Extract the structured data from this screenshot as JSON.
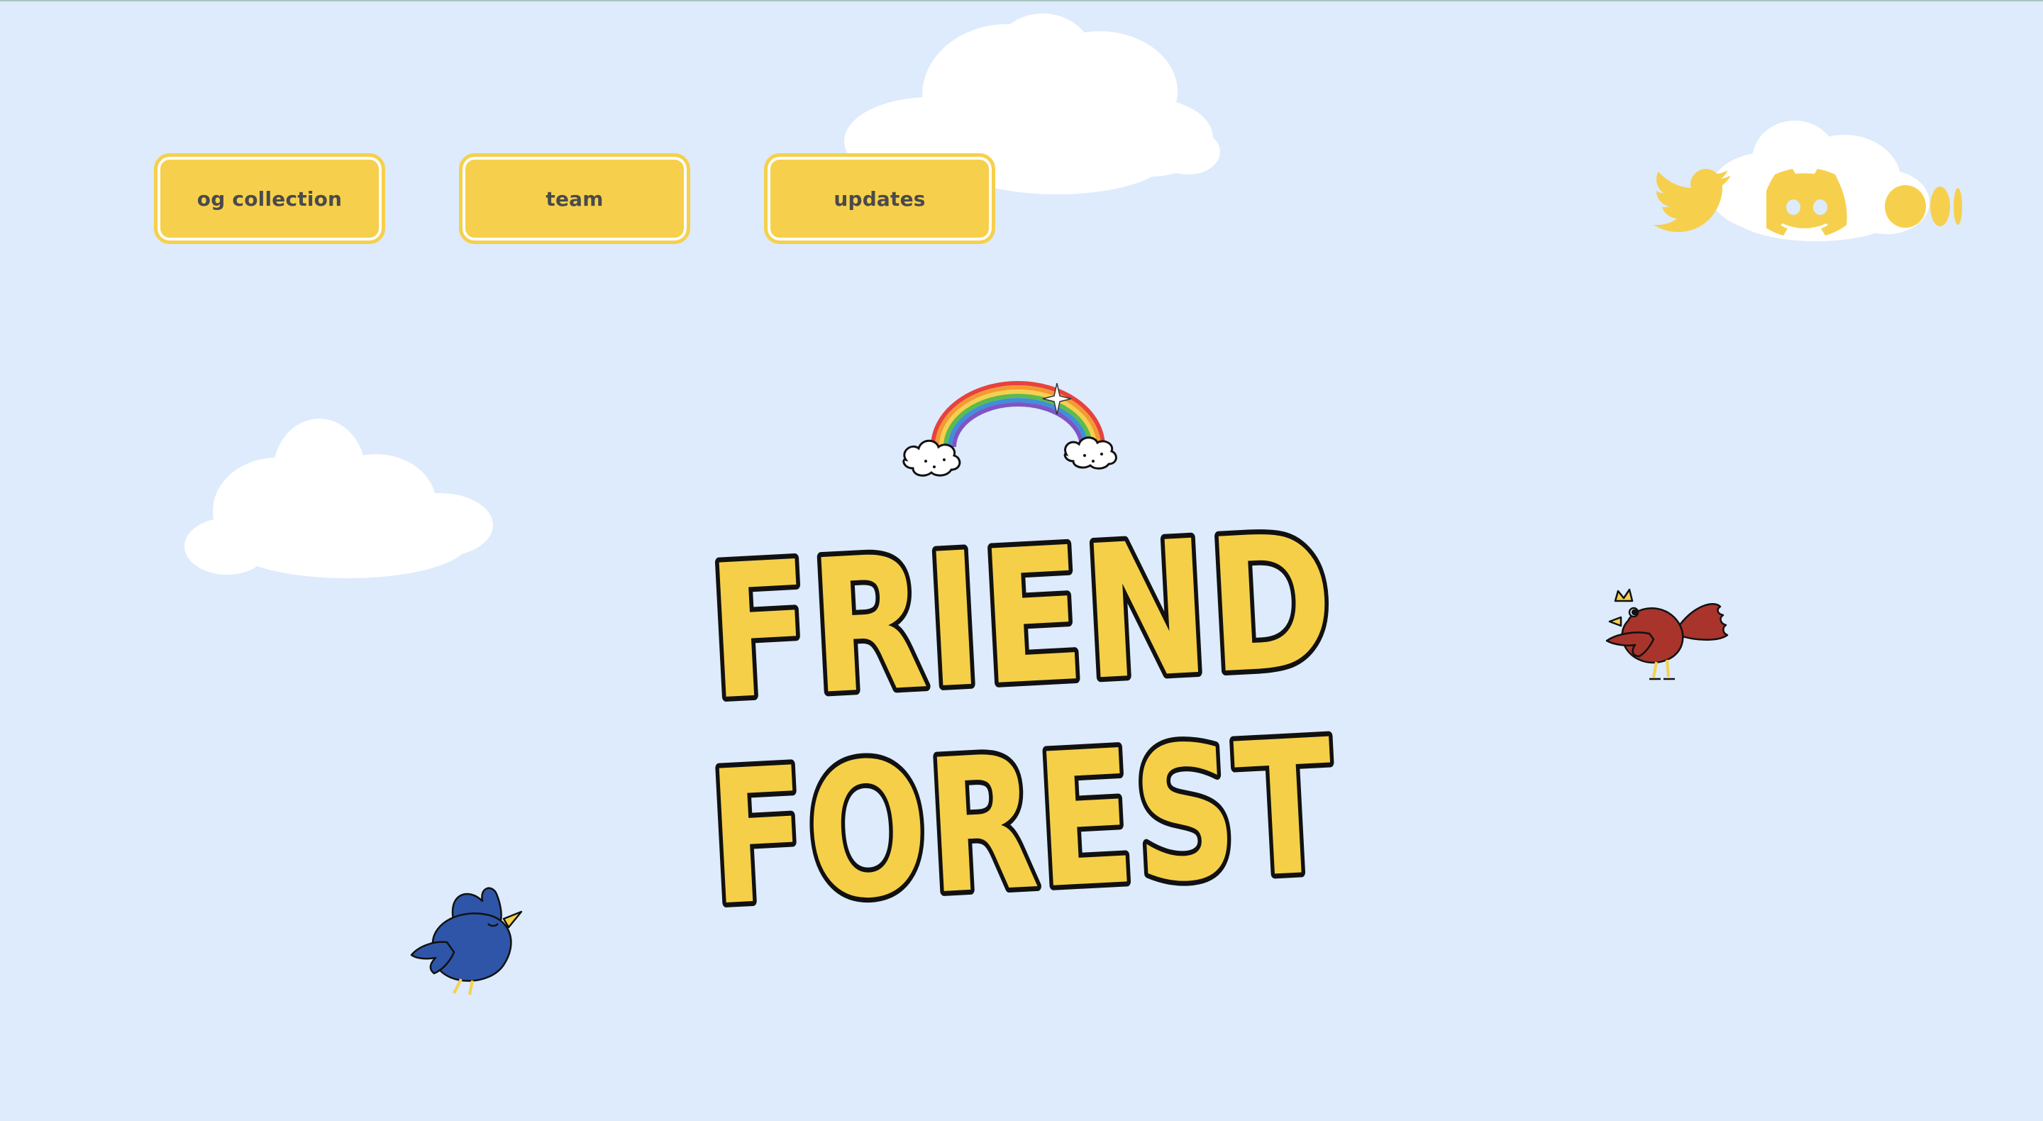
{
  "nav": {
    "items": [
      {
        "label": "og collection"
      },
      {
        "label": "team"
      },
      {
        "label": "updates"
      }
    ]
  },
  "social": {
    "icons": [
      "twitter-icon",
      "discord-icon",
      "medium-icon"
    ]
  },
  "hero": {
    "title_line1": "FRIEND",
    "title_line2": "FOREST"
  },
  "colors": {
    "background": "#DDEBFC",
    "accent_yellow": "#F6D04D",
    "button_text": "#4A4A4A",
    "title_fill": "#F5CF48",
    "title_outline": "#111111",
    "blue_bird": "#2E55A8",
    "red_bird": "#A8342B"
  }
}
